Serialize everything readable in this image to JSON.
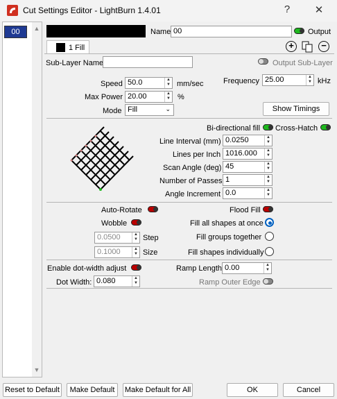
{
  "window": {
    "title": "Cut Settings Editor - LightBurn 1.4.01",
    "help_label": "?",
    "close_label": "✕"
  },
  "layers": {
    "items": [
      {
        "label": "00"
      }
    ]
  },
  "header": {
    "name_label": "Name",
    "name_value": "00",
    "output_label": "Output",
    "tab_label": "1 Fill",
    "sublayer_name_label": "Sub-Layer Name",
    "sublayer_name_value": "",
    "output_sublayer_label": "Output Sub-Layer"
  },
  "params": {
    "speed_label": "Speed",
    "speed_value": "50.0",
    "speed_unit": "mm/sec",
    "max_power_label": "Max Power",
    "max_power_value": "20.00",
    "max_power_unit": "%",
    "mode_label": "Mode",
    "mode_value": "Fill",
    "frequency_label": "Frequency",
    "frequency_value": "25.00",
    "frequency_unit": "kHz",
    "show_timings_label": "Show Timings"
  },
  "fill": {
    "bidirectional_label": "Bi-directional fill",
    "crosshatch_label": "Cross-Hatch",
    "line_interval_label": "Line Interval (mm)",
    "line_interval_value": "0.0250",
    "lpi_label": "Lines per Inch",
    "lpi_value": "1016.000",
    "scan_angle_label": "Scan Angle (deg)",
    "scan_angle_value": "45",
    "passes_label": "Number of Passes",
    "passes_value": "1",
    "angle_inc_label": "Angle Increment",
    "angle_inc_value": "0.0"
  },
  "options": {
    "auto_rotate_label": "Auto-Rotate",
    "wobble_label": "Wobble",
    "step_value": "0.0500",
    "step_label": "Step",
    "size_value": "0.1000",
    "size_label": "Size",
    "flood_fill_label": "Flood Fill",
    "fill_all_label": "Fill all shapes at once",
    "fill_groups_label": "Fill groups together",
    "fill_individually_label": "Fill shapes individually"
  },
  "dot": {
    "enable_dot_label": "Enable dot-width adjust",
    "dot_width_label": "Dot Width:",
    "dot_width_value": "0.080",
    "ramp_length_label": "Ramp Length",
    "ramp_length_value": "0.00",
    "ramp_outer_label": "Ramp Outer Edge"
  },
  "footer": {
    "reset_label": "Reset to Default",
    "make_default_label": "Make Default",
    "make_default_all_label": "Make Default for All",
    "ok_label": "OK",
    "cancel_label": "Cancel"
  },
  "colors": {
    "layer_swatch": "#000000",
    "toggle_on": "#1eb81e",
    "toggle_off": "#bb0000",
    "accent": "#0060c0",
    "app_icon": "#d03020"
  }
}
